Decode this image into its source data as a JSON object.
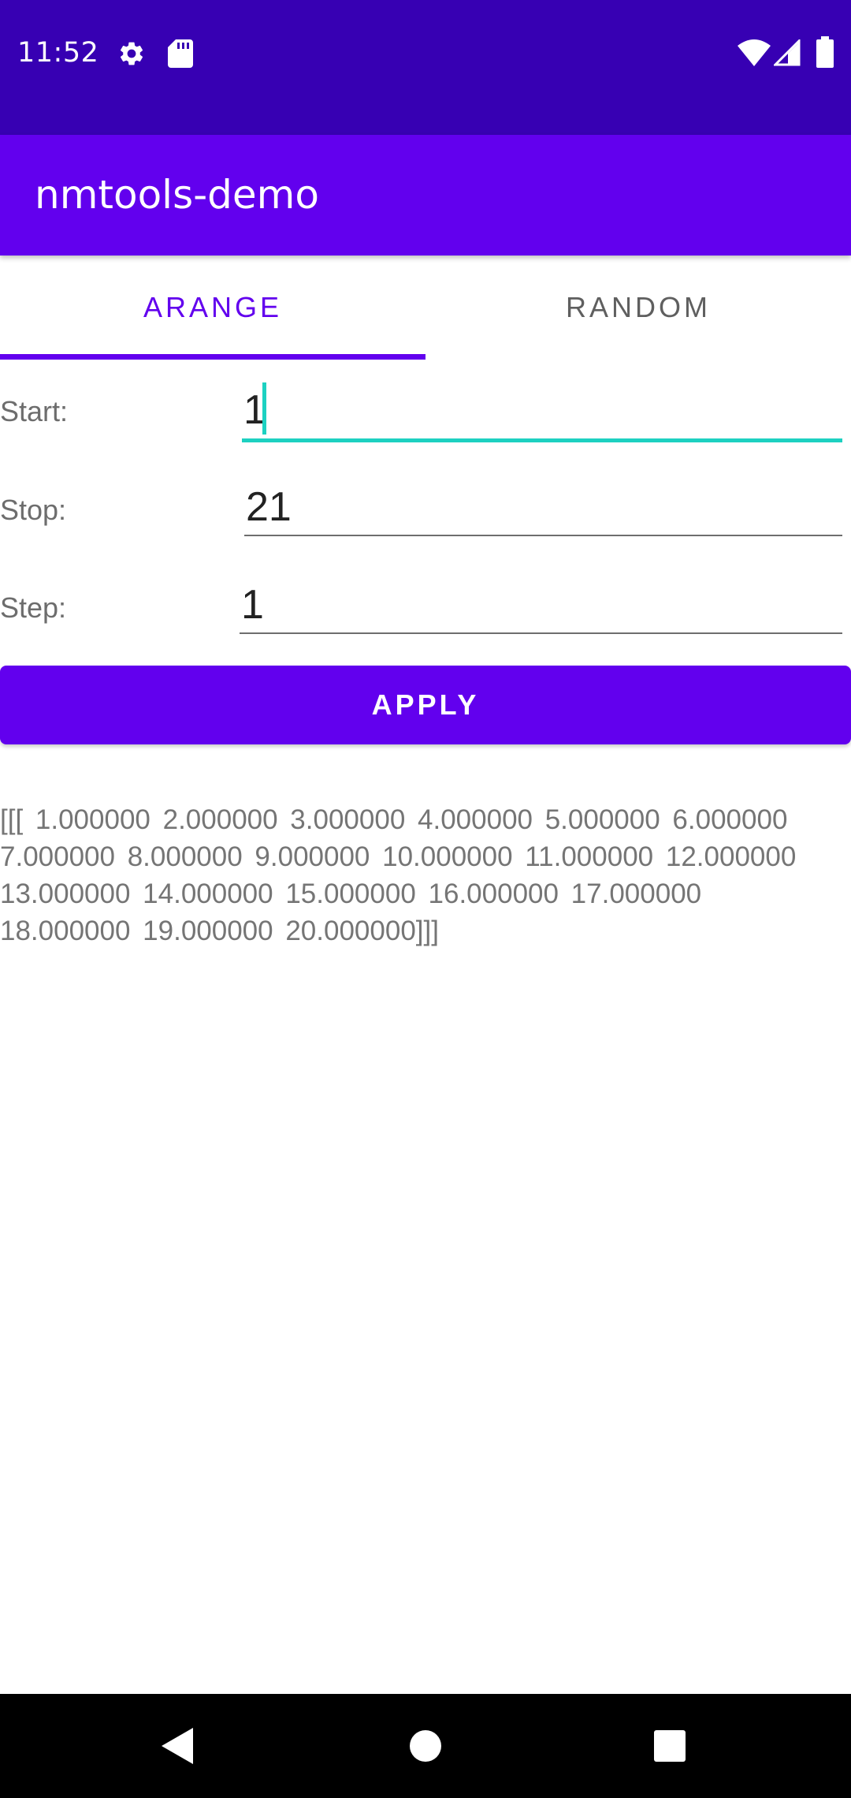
{
  "status_bar": {
    "time": "11:52",
    "left_icons": [
      "gear-icon",
      "sd-card-icon"
    ],
    "right_icons": [
      "wifi-icon",
      "cell-signal-icon",
      "battery-icon"
    ],
    "background_color": "#3700B3"
  },
  "app_bar": {
    "title": "nmtools-demo",
    "background_color": "#6200EE"
  },
  "tabs": [
    {
      "label": "ARANGE",
      "selected": true
    },
    {
      "label": "RANDOM",
      "selected": false
    }
  ],
  "form": {
    "start": {
      "label": "Start:",
      "value": "1",
      "focused": true
    },
    "stop": {
      "label": "Stop:",
      "value": "21",
      "focused": false
    },
    "step": {
      "label": "Step:",
      "value": "1",
      "focused": false
    }
  },
  "apply_button": {
    "label": "APPLY"
  },
  "output": {
    "text": "[[[ 1.000000 2.000000 3.000000 4.000000 5.000000 6.000000 7.000000 8.000000 9.000000 10.000000 11.000000 12.000000 13.000000 14.000000 15.000000 16.000000 17.000000 18.000000 19.000000 20.000000]]]"
  },
  "nav_bar": {
    "buttons": [
      "back-icon",
      "home-icon",
      "recents-icon"
    ]
  },
  "colors": {
    "accent": "#6200EE",
    "focus": "#1DD1C1"
  }
}
